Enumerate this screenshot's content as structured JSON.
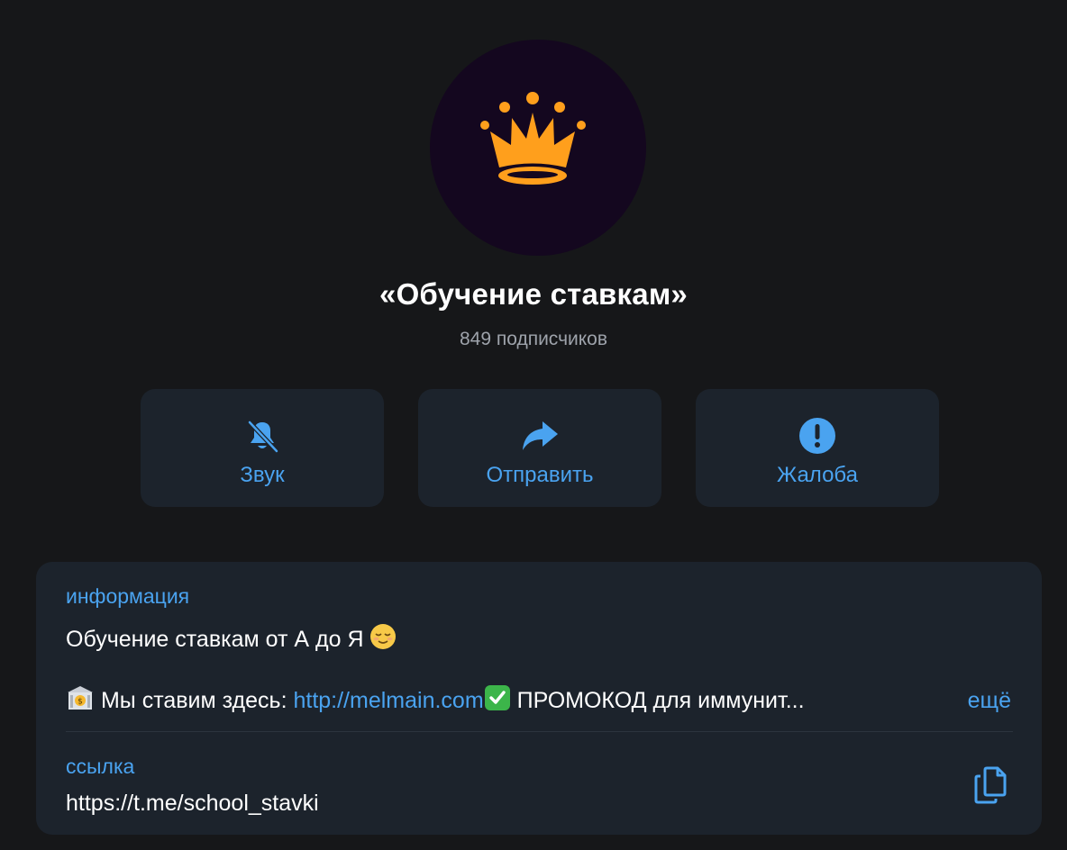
{
  "channel": {
    "title": "«Обучение ставкам»",
    "subscribers": "849 подписчиков",
    "avatar_icon": "crown-icon",
    "avatar_bg": "#14071f",
    "crown_color": "#ff9f1c"
  },
  "actions": [
    {
      "label": "Звук",
      "icon": "bell-slash-icon"
    },
    {
      "label": "Отправить",
      "icon": "share-arrow-icon"
    },
    {
      "label": "Жалоба",
      "icon": "exclamation-circle-icon"
    }
  ],
  "info": {
    "label": "информация",
    "line1": "Обучение ставкам от А до Я",
    "line1_emoji": "relieved-face-emoji",
    "line2_prefix": "Мы ставим здесь: ",
    "line2_link": "http://melmain.com",
    "line2_suffix": " ПРОМОКОД для иммунит...",
    "line2_emojis": [
      "bank-emoji",
      "check-mark-button-emoji"
    ],
    "more": "ещё"
  },
  "link_section": {
    "label": "ссылка",
    "value": "https://t.me/school_stavki",
    "copy_icon": "copy-icon"
  },
  "colors": {
    "background": "#161719",
    "card": "#1c232c",
    "accent": "#4aa3f0",
    "muted": "#9ea3ab"
  }
}
